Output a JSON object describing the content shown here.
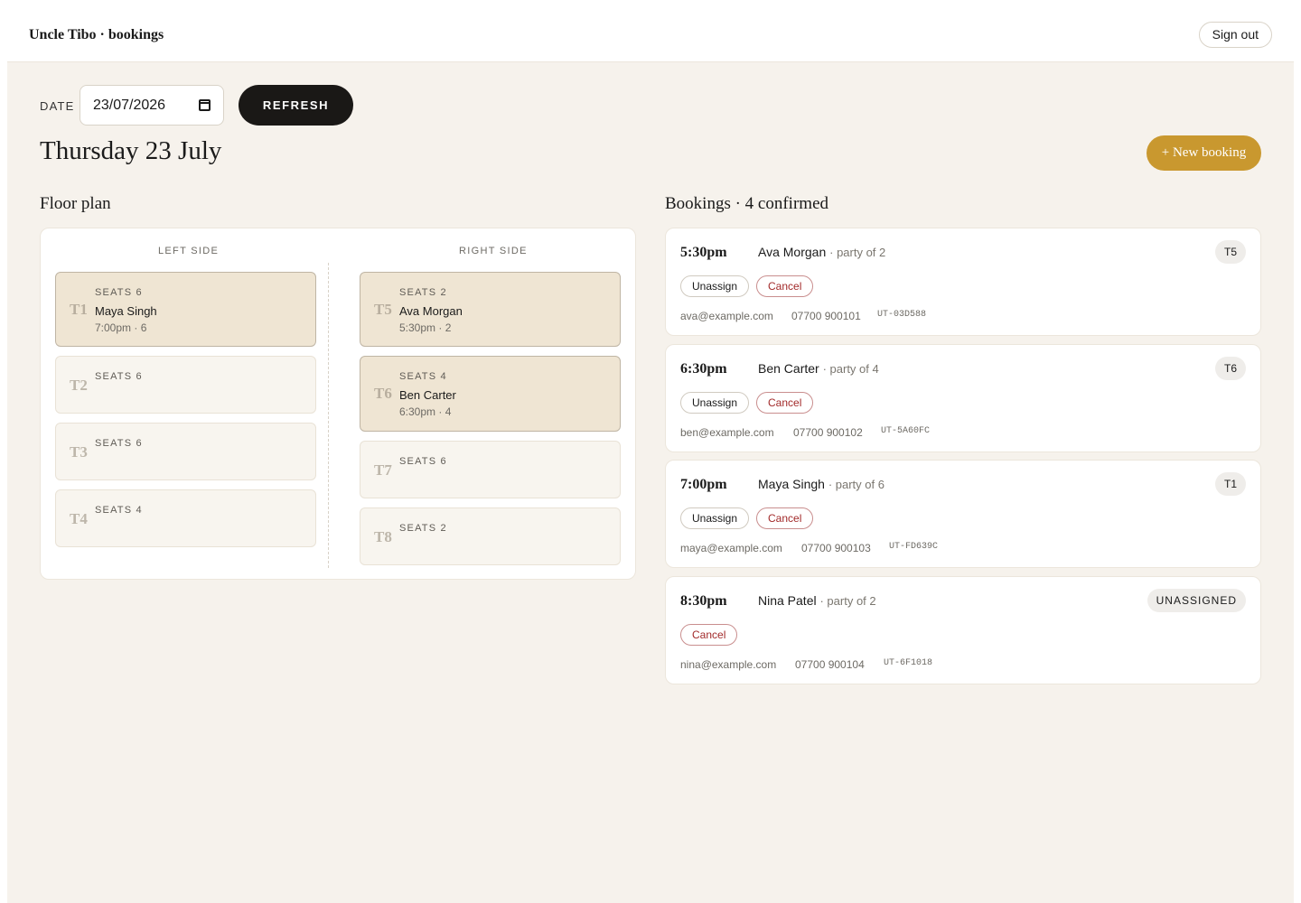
{
  "app": {
    "brand": "Uncle Tibo · bookings",
    "sign_out": "Sign out"
  },
  "controls": {
    "date_label": "DATE",
    "date_value": "23/07/2026",
    "refresh_label": "REFRESH"
  },
  "day_title": "Thursday 23 July",
  "new_booking_label": "+ New booking",
  "floor": {
    "title": "Floor plan",
    "left_label": "LEFT SIDE",
    "right_label": "RIGHT SIDE",
    "left_tables": [
      {
        "id": "T1",
        "seats": "SEATS 6",
        "guest": "Maya Singh",
        "meta": "7:00pm · 6"
      },
      {
        "id": "T2",
        "seats": "SEATS 6"
      },
      {
        "id": "T3",
        "seats": "SEATS 6"
      },
      {
        "id": "T4",
        "seats": "SEATS 4"
      }
    ],
    "right_tables": [
      {
        "id": "T5",
        "seats": "SEATS 2",
        "guest": "Ava Morgan",
        "meta": "5:30pm · 2"
      },
      {
        "id": "T6",
        "seats": "SEATS 4",
        "guest": "Ben Carter",
        "meta": "6:30pm · 4"
      },
      {
        "id": "T7",
        "seats": "SEATS 6"
      },
      {
        "id": "T8",
        "seats": "SEATS 2"
      }
    ]
  },
  "bookings": {
    "title": "Bookings · 4 confirmed",
    "unassign_label": "Unassign",
    "cancel_label": "Cancel",
    "items": [
      {
        "time": "5:30pm",
        "name": "Ava Morgan",
        "party": "· party of 2",
        "table": "T5",
        "email": "ava@example.com",
        "phone": "07700 900101",
        "ref": "UT-03D588"
      },
      {
        "time": "6:30pm",
        "name": "Ben Carter",
        "party": "· party of 4",
        "table": "T6",
        "email": "ben@example.com",
        "phone": "07700 900102",
        "ref": "UT-5A60FC"
      },
      {
        "time": "7:00pm",
        "name": "Maya Singh",
        "party": "· party of 6",
        "table": "T1",
        "email": "maya@example.com",
        "phone": "07700 900103",
        "ref": "UT-FD639C"
      },
      {
        "time": "8:30pm",
        "name": "Nina Patel",
        "party": "· party of 2",
        "table": "UNASSIGNED",
        "email": "nina@example.com",
        "phone": "07700 900104",
        "ref": "UT-6F1018"
      }
    ]
  }
}
